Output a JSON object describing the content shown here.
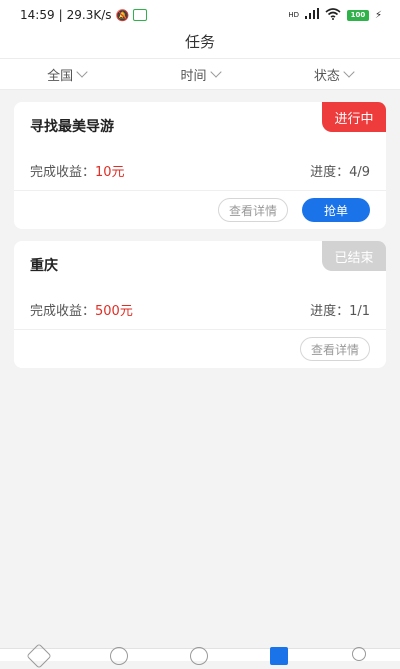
{
  "status_bar": {
    "time": "14:59",
    "network_speed": "29.3K/s",
    "separator": "|",
    "battery": "100",
    "hd_label": "HD"
  },
  "header": {
    "title": "任务"
  },
  "filters": [
    {
      "label": "全国"
    },
    {
      "label": "时间"
    },
    {
      "label": "状态"
    }
  ],
  "tasks": [
    {
      "title": "寻找最美导游",
      "status": "进行中",
      "reward_label": "完成收益：",
      "reward_value": "10元",
      "progress_label": "进度：",
      "progress_value": "4/9",
      "detail_button": "查看详情",
      "grab_button": "抢单"
    },
    {
      "title": "重庆",
      "status": "已结束",
      "reward_label": "完成收益：",
      "reward_value": "500元",
      "progress_label": "进度：",
      "progress_value": "1/1",
      "detail_button": "查看详情"
    }
  ],
  "colors": {
    "accent": "#1a73e8",
    "status_active": "#ee3b3b",
    "status_ended": "#d2d2d2",
    "reward_text": "#e02e24"
  },
  "tab_icons": [
    "home-icon",
    "compass-icon",
    "circle-icon",
    "task-icon",
    "profile-icon"
  ]
}
